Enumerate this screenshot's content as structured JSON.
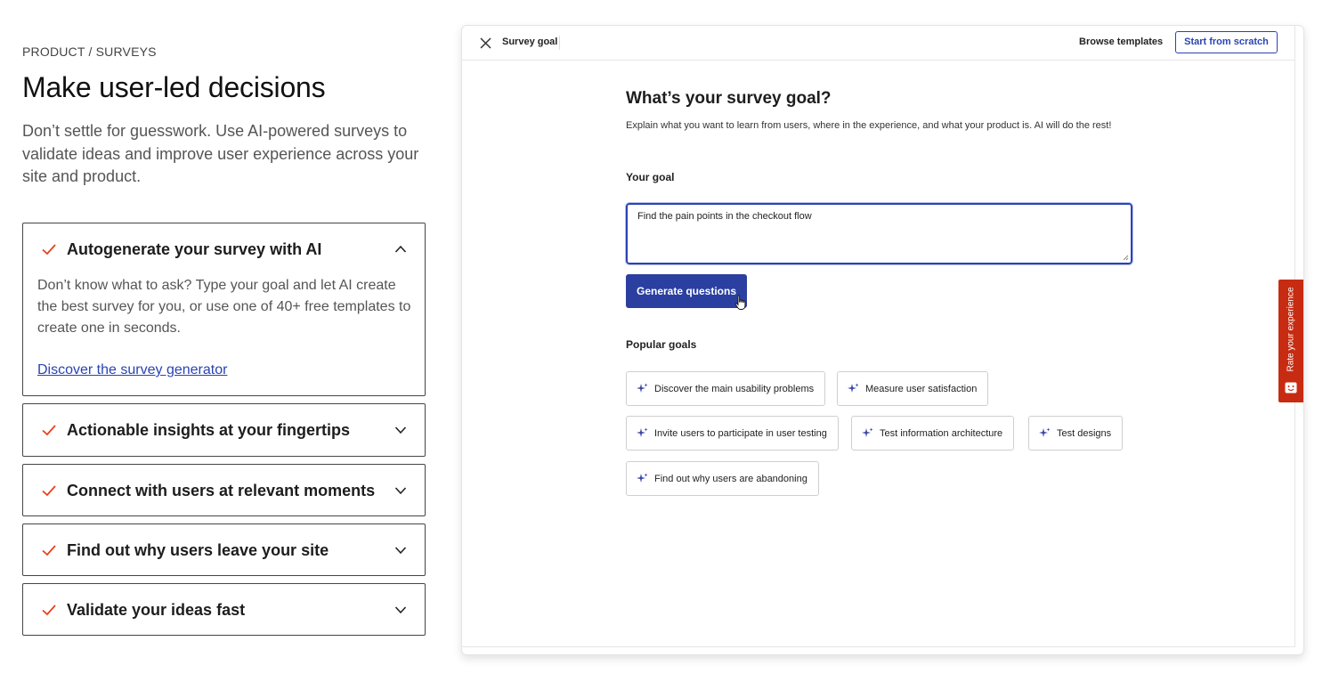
{
  "left": {
    "eyebrow": "PRODUCT / SURVEYS",
    "headline": "Make user-led decisions",
    "lede": "Don’t settle for guesswork. Use AI-powered surveys to validate ideas and improve user experience across your site and product.",
    "accordion": [
      {
        "title": "Autogenerate your survey with AI",
        "expanded": true,
        "body": "Don’t know what to ask? Type your goal and let AI create the best survey for you, or use one of 40+ free templates to create one in seconds.",
        "link": "Discover the survey generator"
      },
      {
        "title": "Actionable insights at your fingertips",
        "expanded": false
      },
      {
        "title": "Connect with users at relevant moments",
        "expanded": false
      },
      {
        "title": "Find out why users leave your site",
        "expanded": false
      },
      {
        "title": "Validate your ideas fast",
        "expanded": false
      }
    ]
  },
  "app": {
    "topbar": {
      "title": "Survey goal",
      "browse": "Browse templates",
      "scratch": "Start from scratch"
    },
    "title": "What’s your survey goal?",
    "subtitle": "Explain what you want to learn from users, where in the experience, and what your product is. AI will do the rest!",
    "goal_label": "Your goal",
    "goal_value": "Find the pain points in the checkout flow",
    "generate_label": "Generate questions",
    "popular_label": "Popular goals",
    "popular_goals": [
      "Discover the main usability problems",
      "Measure user satisfaction",
      "Invite users to participate in user testing",
      "Test information architecture",
      "Test designs",
      "Find out why users are abandoning"
    ]
  },
  "feedback_tab": {
    "label": "Rate your experience"
  },
  "colors": {
    "accent": "#2a3f9f",
    "check": "#e8401c",
    "feedback": "#c72c12",
    "link": "#2a43b3"
  },
  "icons": [
    "check-icon",
    "chevron-up-icon",
    "chevron-down-icon",
    "close-icon",
    "sparkle-icon",
    "pointer-cursor-icon",
    "smiley-icon"
  ]
}
